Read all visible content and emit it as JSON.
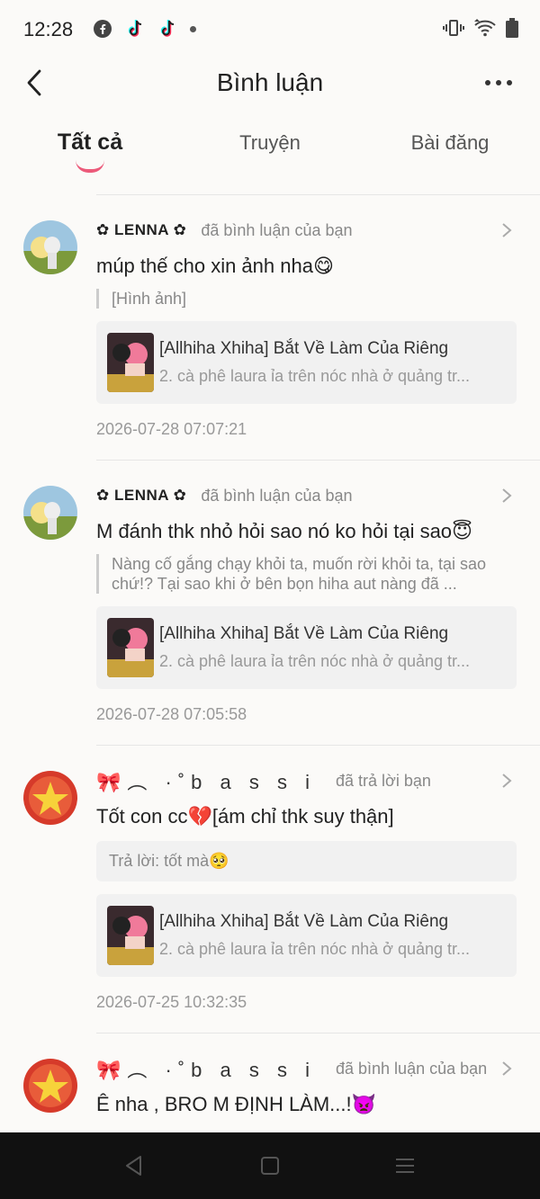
{
  "status_bar": {
    "time": "12:28",
    "left_icons": [
      "facebook-icon",
      "tiktok-icon",
      "tiktok-icon",
      "dot"
    ],
    "right_icons": [
      "vibrate-icon",
      "wifi-icon",
      "battery-icon"
    ]
  },
  "header": {
    "title": "Bình luận",
    "back_icon": "chevron-left-icon",
    "more_icon": "more-horizontal-icon"
  },
  "tabs": [
    {
      "label": "Tất cả",
      "active": true
    },
    {
      "label": "Truyện",
      "active": false
    },
    {
      "label": "Bài đăng",
      "active": false
    }
  ],
  "colors": {
    "accent": "#ec5a7a",
    "background": "#fbfaf8",
    "card": "#f1f1f1",
    "muted": "#888888"
  },
  "items": [
    {
      "user": "✿ LENNA ✿",
      "action": "đã bình luận của bạn",
      "comment": "múp thế cho xin ảnh nha😋",
      "quote": "[Hình ảnh]",
      "story_title": "[Allhiha Xhiha] Bắt Về Làm Của Riêng",
      "story_sub": "2. cà phê laura ỉa trên nóc nhà ở quảng tr...",
      "timestamp": "2026-07-28 07:07:21"
    },
    {
      "user": "✿ LENNA ✿",
      "action": "đã bình luận của bạn",
      "comment": "M đánh thk nhỏ hỏi sao nó ko hỏi tại sao😇",
      "quote": "Nàng cố gắng chạy khỏi ta, muốn rời khỏi ta, tại sao chứ!? Tại sao khi ở bên bọn hiha aut nàng đã ...",
      "story_title": "[Allhiha Xhiha] Bắt Về Làm Của Riêng",
      "story_sub": "2. cà phê laura ỉa trên nóc nhà ở quảng tr...",
      "timestamp": "2026-07-28 07:05:58"
    },
    {
      "user": "🎀︵ ·˚b a s s i e…",
      "action": "đã trả lời bạn",
      "comment": "Tốt con cc💔[ám chỉ thk suy thận]",
      "reply": "Trả lời: tốt mà🥺",
      "story_title": "[Allhiha Xhiha] Bắt Về Làm Của Riêng",
      "story_sub": "2. cà phê laura ỉa trên nóc nhà ở quảng tr...",
      "timestamp": "2026-07-25 10:32:35"
    },
    {
      "user": "🎀︵ ·˚b a s s i e…",
      "action": "đã bình luận của bạn",
      "comment": "Ê nha , BRO M ĐỊNH LÀM...!👿"
    }
  ],
  "nav_bar": [
    "back-triangle-icon",
    "home-square-icon",
    "menu-lines-icon"
  ]
}
